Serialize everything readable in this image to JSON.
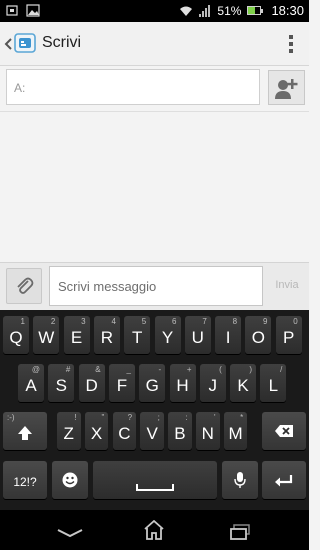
{
  "status_bar": {
    "battery": "51%",
    "time": "18:30",
    "battery_level": 0.51,
    "battery_color": "#7fd14a"
  },
  "action_bar": {
    "title": "Scrivi",
    "app_icon": "messaging-icon",
    "overflow_icon": "overflow-menu-icon"
  },
  "recipient": {
    "placeholder": "A:",
    "add_contact_icon": "add-contact-icon"
  },
  "compose": {
    "placeholder": "Scrivi messaggio",
    "send_label": "Invia",
    "attach_icon": "paperclip-icon"
  },
  "keyboard": {
    "row1": [
      {
        "k": "Q",
        "s": "1"
      },
      {
        "k": "W",
        "s": "2"
      },
      {
        "k": "E",
        "s": "3"
      },
      {
        "k": "R",
        "s": "4"
      },
      {
        "k": "T",
        "s": "5"
      },
      {
        "k": "Y",
        "s": "6"
      },
      {
        "k": "U",
        "s": "7"
      },
      {
        "k": "I",
        "s": "8"
      },
      {
        "k": "O",
        "s": "9"
      },
      {
        "k": "P",
        "s": "0"
      }
    ],
    "row2": [
      {
        "k": "A",
        "s": "@"
      },
      {
        "k": "S",
        "s": "#"
      },
      {
        "k": "D",
        "s": "&"
      },
      {
        "k": "F",
        "s": "_"
      },
      {
        "k": "G",
        "s": "-"
      },
      {
        "k": "H",
        "s": "+"
      },
      {
        "k": "J",
        "s": "("
      },
      {
        "k": "K",
        "s": ")"
      },
      {
        "k": "L",
        "s": "/"
      }
    ],
    "row3": [
      {
        "k": "Z",
        "s": "!"
      },
      {
        "k": "X",
        "s": "\""
      },
      {
        "k": "C",
        "s": "?"
      },
      {
        "k": "V",
        "s": ";"
      },
      {
        "k": "B",
        "s": ":"
      },
      {
        "k": "N",
        "s": "'"
      },
      {
        "k": "M",
        "s": "*"
      }
    ],
    "shift_sup": ":-)",
    "symbols_label": "12!?",
    "emoji_icon": "smiley-icon",
    "mic_icon": "microphone-icon",
    "enter_icon": "enter-icon",
    "backspace_icon": "backspace-icon",
    "space_icon": "space-icon"
  },
  "nav_bar": {
    "back_icon": "back-icon",
    "home_icon": "home-icon",
    "recents_icon": "recent-apps-icon"
  }
}
